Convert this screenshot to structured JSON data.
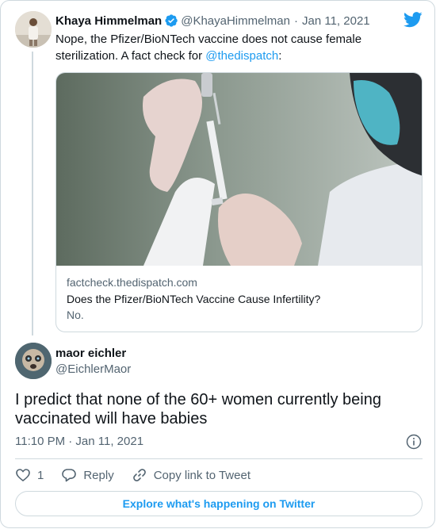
{
  "tweet": {
    "author_name": "Khaya Himmelman",
    "author_handle": "@KhayaHimmelman",
    "separator": "·",
    "date": "Jan 11, 2021",
    "text_before_mention": "Nope, the Pfizer/BioNTech vaccine does not cause female sterilization. A fact check for ",
    "mention": "@thedispatch",
    "text_after_mention": ":",
    "link_card": {
      "domain": "factcheck.thedispatch.com",
      "title": "Does the Pfizer/BioNTech Vaccine Cause Infertility?",
      "description": "No."
    }
  },
  "reply": {
    "author_name": "maor eichler",
    "author_handle": "@EichlerMaor",
    "text": "I predict that none of the 60+ women currently being vaccinated will have babies",
    "timestamp": "11:10 PM · Jan 11, 2021"
  },
  "actions": {
    "like_count": "1",
    "reply_label": "Reply",
    "copy_link_label": "Copy link to Tweet"
  },
  "explore_label": "Explore what's happening on Twitter",
  "icons": [
    "twitter-logo-icon",
    "verified-badge-icon",
    "info-icon",
    "heart-icon",
    "reply-bubble-icon",
    "link-icon"
  ],
  "colors": {
    "accent": "#1d9bf0",
    "text": "#0f1419",
    "secondary": "#536471",
    "border": "#cfd9de"
  }
}
